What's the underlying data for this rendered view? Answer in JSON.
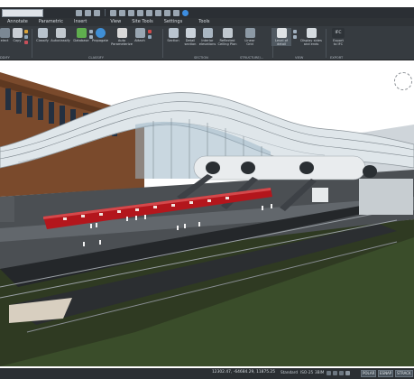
{
  "tabs": [
    "Annotate",
    "Parametric",
    "Insert",
    "View",
    "Site Tools",
    "Settings",
    "Tools"
  ],
  "ribbon": {
    "buttons": {
      "select": "elect",
      "copy": "Copy",
      "classify": "Classify",
      "autoclassify": "Autoclassify",
      "database": "Database",
      "propagate": "Propagate",
      "auto_parameterize": "Auto\nParameterize",
      "attach": "Attach",
      "section": "Section",
      "detail_section": "Detail\nsection",
      "interior_elevations": "Interior\nelevations",
      "reflected_ceiling_plan": "Reflected\nCeiling Plan",
      "linear_grid": "Linear\nGrid",
      "level_of_detail": "Level of\ndetail",
      "display_sides_and_ends": "Display sides\nand ends",
      "export_to_ifc": "Export\nto IFC",
      "ifc_badge": "IFC"
    },
    "groups": {
      "modify": "DDIFY",
      "classify": "CLASSIFY",
      "section": "SECTION",
      "structure": "STRUCTURE/...",
      "view": "VIEW",
      "export": "EXPORT"
    }
  },
  "status_bar": {
    "coordinates": "12302.47, -64684.29, 11875.25",
    "items": [
      "Standard",
      "ISO-25",
      "3BIM"
    ],
    "toggles": [
      "POLAR",
      "ESNAP",
      "STRACK"
    ]
  },
  "colors": {
    "ribbon_bg": "#363b40",
    "statusbar_bg": "#2b2f33",
    "train_red": "#b3161c",
    "roof_steel": "#dfe6ea"
  },
  "icons": {
    "viewcube": "viewcube-compass-icon"
  }
}
